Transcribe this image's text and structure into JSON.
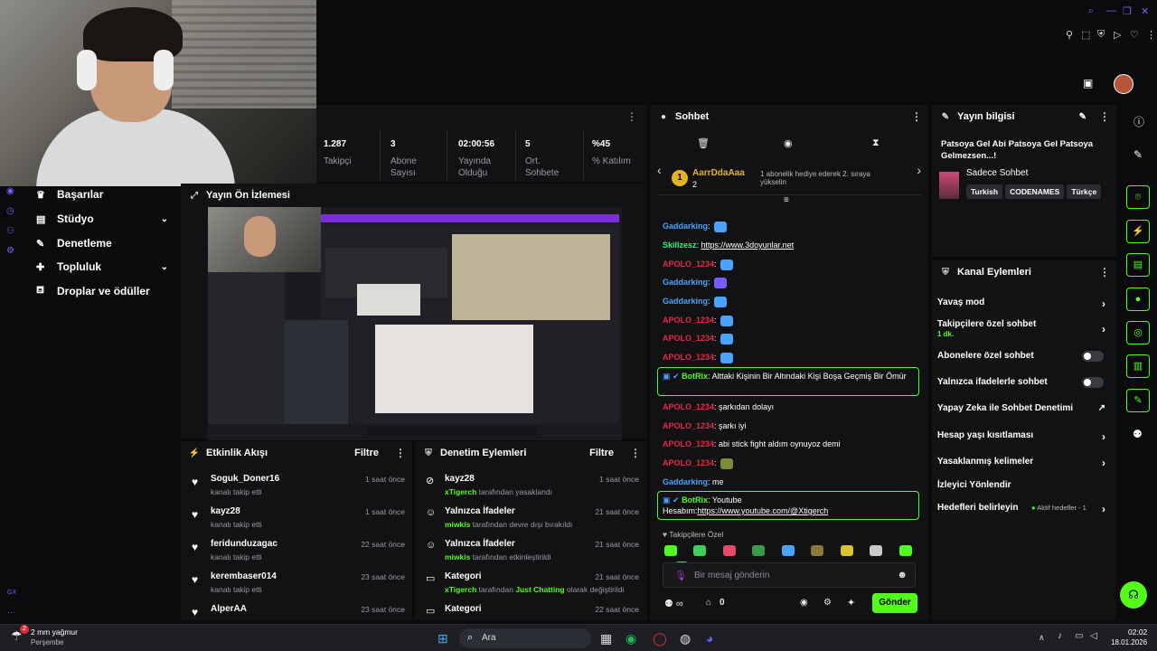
{
  "top_right_icons": [
    "search-icon",
    "minimize-icon",
    "restore-icon",
    "close-icon",
    "heart-icon"
  ],
  "stats": [
    {
      "value": "1.287",
      "label": "Takipçi"
    },
    {
      "value": "3",
      "label": "Abone Sayısı"
    },
    {
      "value": "02:00:56",
      "label": "Yayında Olduğu"
    },
    {
      "value": "5",
      "label": "Ort. Sohbete"
    },
    {
      "value": "%45",
      "label": "% Katılım"
    }
  ],
  "nav": {
    "items": [
      {
        "label": "Başarılar",
        "icon": "trophy-icon",
        "chevron": false
      },
      {
        "label": "Stüdyo",
        "icon": "studio-icon",
        "chevron": true
      },
      {
        "label": "Denetleme",
        "icon": "wrench-icon",
        "chevron": false
      },
      {
        "label": "Topluluk",
        "icon": "community-icon",
        "chevron": true
      },
      {
        "label": "Droplar ve ödüller",
        "icon": "drops-icon",
        "chevron": false
      }
    ],
    "bottom_label": "GX"
  },
  "preview": {
    "title": "Yayın Ön İzlemesi"
  },
  "activity": {
    "title": "Etkinlik Akışı",
    "filter": "Filtre",
    "rows": [
      {
        "name": "Soguk_Doner16",
        "sub": "kanalı takip etti",
        "time": "1 saat önce"
      },
      {
        "name": "kayz28",
        "sub": "kanalı takip etti",
        "time": "1 saat önce"
      },
      {
        "name": "feridunduzagac",
        "sub": "kanalı takip etti",
        "time": "22 saat önce"
      },
      {
        "name": "kerembaser014",
        "sub": "kanalı takip etti",
        "time": "23 saat önce"
      },
      {
        "name": "AlperAA",
        "sub": "",
        "time": "23 saat önce"
      }
    ]
  },
  "moderation": {
    "title": "Denetim Eylemleri",
    "filter": "Filtre",
    "rows": [
      {
        "name": "kayz28",
        "actor": "xTigerch",
        "sub": "tarafından yasaklandı",
        "time": "1 saat önce",
        "icon": "ban-icon"
      },
      {
        "name": "Yalnızca İfadeler",
        "actor": "miwkis",
        "sub": "tarafından devre dışı bırakıldı",
        "time": "21 saat önce",
        "icon": "emote-icon"
      },
      {
        "name": "Yalnızca İfadeler",
        "actor": "miwkis",
        "sub": "tarafından etkinleştirildi",
        "time": "21 saat önce",
        "icon": "emote-icon"
      },
      {
        "name": "Kategori",
        "actor": "xTigerch",
        "sub": "tarafından",
        "category": "Just Chatting",
        "sub2": "olarak değiştirildi",
        "time": "21 saat önce",
        "icon": "category-icon"
      },
      {
        "name": "Kategori",
        "actor": "",
        "sub": "",
        "time": "22 saat önce",
        "icon": "category-icon"
      }
    ]
  },
  "chat": {
    "title": "Sohbet",
    "gift_user": "AarrDdaAaa",
    "gift_count": "2",
    "gift_text": "1 abonelik hediye ederek 2. sıraya yükselin",
    "messages": [
      {
        "user": "Gaddarking",
        "text": "",
        "emote": "#4aa3ff",
        "cls": "u3"
      },
      {
        "user": "Skillzesz",
        "text": "https://www.3doyunlar.net",
        "link": true,
        "cls": "u4"
      },
      {
        "user": "APOLO_1234",
        "text": "",
        "emote": "#4aa3ff",
        "cls": "u2"
      },
      {
        "user": "Gaddarking",
        "text": "",
        "emote": "#7b5cff",
        "cls": "u3"
      },
      {
        "user": "Gaddarking",
        "text": "",
        "emote": "#4aa3ff",
        "cls": "u3"
      },
      {
        "user": "APOLO_1234",
        "text": "",
        "emote": "#4aa3ff",
        "cls": "u2"
      },
      {
        "user": "APOLO_1234",
        "text": "",
        "emote": "#4aa3ff",
        "cls": "u2"
      },
      {
        "user": "APOLO_1234",
        "text": "",
        "emote": "#4aa3ff",
        "cls": "u2"
      }
    ],
    "bot1": {
      "user": "BotRix",
      "text": "Alttaki Kişinin Bir Altındaki Kişi Boşa Geçmiş Bir Ömür"
    },
    "messages2": [
      {
        "user": "APOLO_1234",
        "text": "şarkıdan dolayı",
        "cls": "u2"
      },
      {
        "user": "APOLO_1234",
        "text": "şarkı iyi",
        "cls": "u2"
      },
      {
        "user": "APOLO_1234",
        "text": "abi stick fight aldım oynuyoz demi",
        "cls": "u2"
      },
      {
        "user": "APOLO_1234",
        "text": "",
        "emote": "#7a8c3a",
        "cls": "u2"
      },
      {
        "user": "Gaddarking",
        "text": "me",
        "cls": "u3"
      }
    ],
    "bot2": {
      "user": "BotRix",
      "text": "Youtube",
      "text2": "Hesabım:",
      "link": "https://www.youtube.com/@Xtigerch"
    },
    "follower_label": "Takipçilere Özel",
    "input_placeholder": "Bir mesaj gönderin",
    "points": "0",
    "send_label": "Gönder"
  },
  "info": {
    "title": "Yayın bilgisi",
    "stream_title": "Patsoya Gel Abi Patsoya Gel Patsoya Gelmezsen...!",
    "category": "Sadece Sohbet",
    "tags": [
      "Turkish",
      "CODENAMES",
      "Türkçe"
    ]
  },
  "channel_actions": {
    "title": "Kanal Eylemleri",
    "rows": [
      {
        "label": "Yavaş mod",
        "type": "chevron"
      },
      {
        "label": "Takipçilere özel sohbet",
        "sub": "1 dk.",
        "type": "chevron"
      },
      {
        "label": "Abonelere özel sohbet",
        "type": "toggle"
      },
      {
        "label": "Yalnızca ifadelerle sohbet",
        "type": "toggle"
      },
      {
        "label": "Yapay Zeka ile Sohbet Denetimi",
        "type": "external"
      },
      {
        "label": "Hesap yaşı kısıtlaması",
        "type": "chevron"
      },
      {
        "label": "Yasaklanmış kelimeler",
        "type": "chevron"
      },
      {
        "label": "İzleyici Yönlendir",
        "type": "none"
      },
      {
        "label": "Hedefleri belirleyin",
        "sub": "Aktif hedefler - 1",
        "type": "chevron"
      }
    ]
  },
  "taskbar": {
    "weather": "2 mm yağmur",
    "weather_day": "Perşembe",
    "weather_badge": "2",
    "search": "Ara",
    "time": "02:02",
    "date": "18.01.2026"
  },
  "colors": {
    "accent": "#53fc18",
    "panel": "#121214",
    "bg": "#0b0b0d"
  }
}
